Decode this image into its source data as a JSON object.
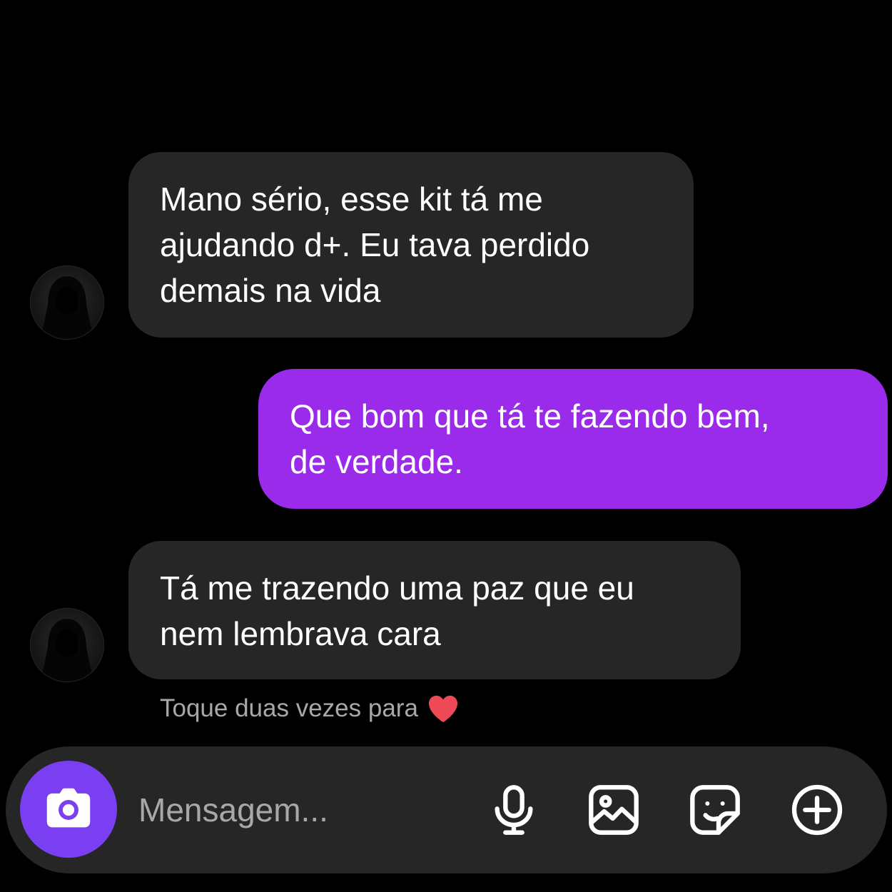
{
  "messages": [
    {
      "direction": "received",
      "text": "Mano sério, esse kit tá me\najudando d+. Eu tava perdido\ndemais na vida"
    },
    {
      "direction": "sent",
      "text": "Que bom que tá te fazendo bem,\nde verdade."
    },
    {
      "direction": "received",
      "text": "Tá me trazendo uma paz que eu\nnem lembrava cara"
    }
  ],
  "hint": {
    "text": "Toque duas vezes para",
    "icon": "heart-icon"
  },
  "composer": {
    "placeholder": "Mensagem...",
    "camera_icon": "camera-icon",
    "tools": [
      "microphone-icon",
      "image-icon",
      "sticker-icon",
      "plus-circle-icon"
    ]
  },
  "colors": {
    "background": "#000000",
    "received_bubble": "#262626",
    "sent_bubble": "#9b2bea",
    "camera_button": "#7b3ff2",
    "hint_text": "#a8a8a8",
    "heart": "#ed4956"
  }
}
